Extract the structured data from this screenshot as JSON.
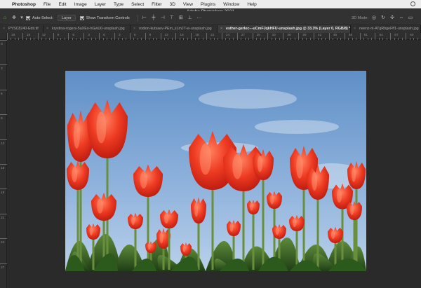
{
  "menubar": {
    "items": [
      "Photoshop",
      "File",
      "Edit",
      "Image",
      "Layer",
      "Type",
      "Select",
      "Filter",
      "3D",
      "View",
      "Plugins",
      "Window",
      "Help"
    ]
  },
  "titlebar": {
    "title": "Adobe Photoshop 2021"
  },
  "options": {
    "auto_select_label": "Auto-Select:",
    "auto_select_checked": true,
    "layer_dropdown": "Layer",
    "show_transform_label": "Show Transform Controls",
    "show_transform_checked": true,
    "mode_label": "3D Mode:"
  },
  "tabs": [
    {
      "label": "PYSC8240-Edit.tif",
      "active": false
    },
    {
      "label": "krystina-rogers-5aXEo-hGwU0-unsplash.jpg",
      "active": false
    },
    {
      "label": "rodion-kutsaev-PEm_sLmJT-w-unsplash.jpg",
      "active": false
    },
    {
      "label": "esther-gerlec---uCmFJqkHFU-unsplash.jpg @ 33.3% (Layer 0, RGB/8) *",
      "active": true
    },
    {
      "label": "neenz-nl-ATgRbgeFff1-unsplash.jpg",
      "active": false
    }
  ],
  "ruler_h": [
    "18",
    "15",
    "12",
    "9",
    "6",
    "3",
    "0",
    "3",
    "6",
    "9",
    "12",
    "15",
    "18",
    "21",
    "24",
    "27",
    "30",
    "33",
    "36",
    "39",
    "42",
    "45",
    "48",
    "51",
    "54",
    "57",
    "60"
  ],
  "ruler_v": [
    "0",
    "3",
    "6",
    "9",
    "12",
    "15",
    "18",
    "21",
    "24",
    "27"
  ],
  "colors": {
    "sky_top": "#5f90c8",
    "sky_bottom": "#a9c4e3",
    "tulip": "#e8321e",
    "leaf": "#2f5a21"
  }
}
